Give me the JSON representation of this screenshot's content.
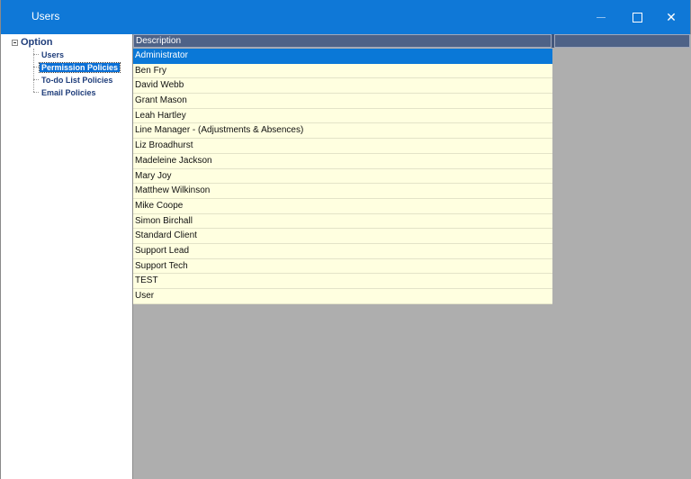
{
  "window": {
    "title": "Users",
    "controls": {
      "minimize": "—",
      "close": "✕"
    },
    "accent_color": "#0f78d7"
  },
  "tree": {
    "root_label": "Option",
    "items": [
      {
        "label": "Users"
      },
      {
        "label": "Permission Policies",
        "selected": true
      },
      {
        "label": "To-do List Policies"
      },
      {
        "label": "Email Policies"
      }
    ]
  },
  "grid": {
    "column_header": "Description",
    "rows": [
      "Administrator",
      "Ben Fry",
      "David Webb",
      "Grant Mason",
      "Leah Hartley",
      "Line Manager - (Adjustments & Absences)",
      "Liz Broadhurst",
      "Madeleine Jackson",
      "Mary Joy",
      "Matthew Wilkinson",
      "Mike Coope",
      "Simon Birchall",
      "Standard Client",
      "Support Lead",
      "Support Tech",
      "TEST",
      "User"
    ],
    "selected_row": 0,
    "row_background": "#ffffe0",
    "selection_color": "#0a78d7"
  }
}
